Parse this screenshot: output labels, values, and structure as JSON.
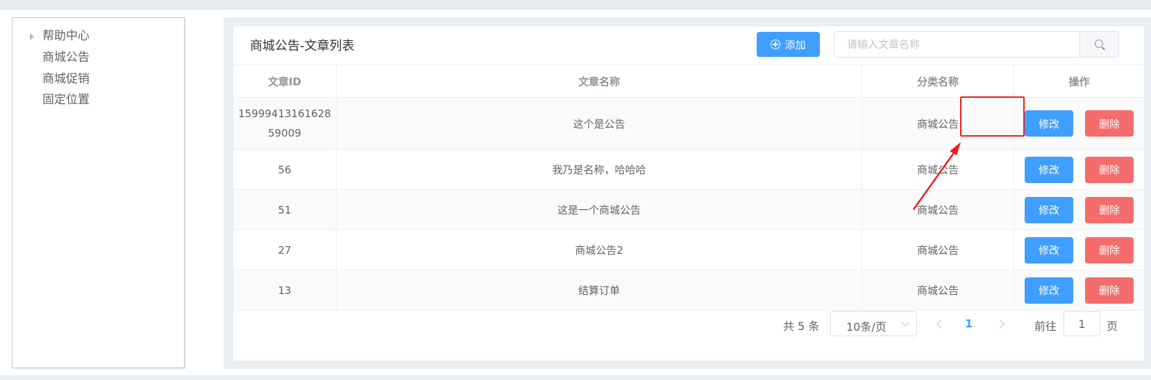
{
  "sidebar": {
    "items": [
      {
        "label": "帮助中心",
        "has_arrow": true
      },
      {
        "label": "商城公告",
        "has_arrow": false
      },
      {
        "label": "商城促销",
        "has_arrow": false
      },
      {
        "label": "固定位置",
        "has_arrow": false
      }
    ]
  },
  "main": {
    "title": "商城公告-文章列表",
    "add_label": "添加",
    "search": {
      "placeholder": "请输入文章名称",
      "value": ""
    },
    "table": {
      "headers": [
        "文章ID",
        "文章名称",
        "分类名称",
        "操作"
      ],
      "rows": [
        {
          "id": "1599941316162859009",
          "name": "这个是公告",
          "category": "商城公告"
        },
        {
          "id": "56",
          "name": "我乃是名称，哈哈哈",
          "category": "商城公告"
        },
        {
          "id": "51",
          "name": "这是一个商城公告",
          "category": "商城公告"
        },
        {
          "id": "27",
          "name": "商城公告2",
          "category": "商城公告"
        },
        {
          "id": "13",
          "name": "结算订单",
          "category": "商城公告"
        }
      ],
      "edit_label": "修改",
      "delete_label": "删除"
    },
    "pagination": {
      "total": "共 5 条",
      "page_size": "10条/页",
      "current_page": "1",
      "goto_label": "前往",
      "goto_value": "1",
      "page_unit": "页"
    }
  },
  "colors": {
    "primary": "#409eff",
    "danger": "#f56c6c",
    "annotation": "#ee1d1d"
  }
}
